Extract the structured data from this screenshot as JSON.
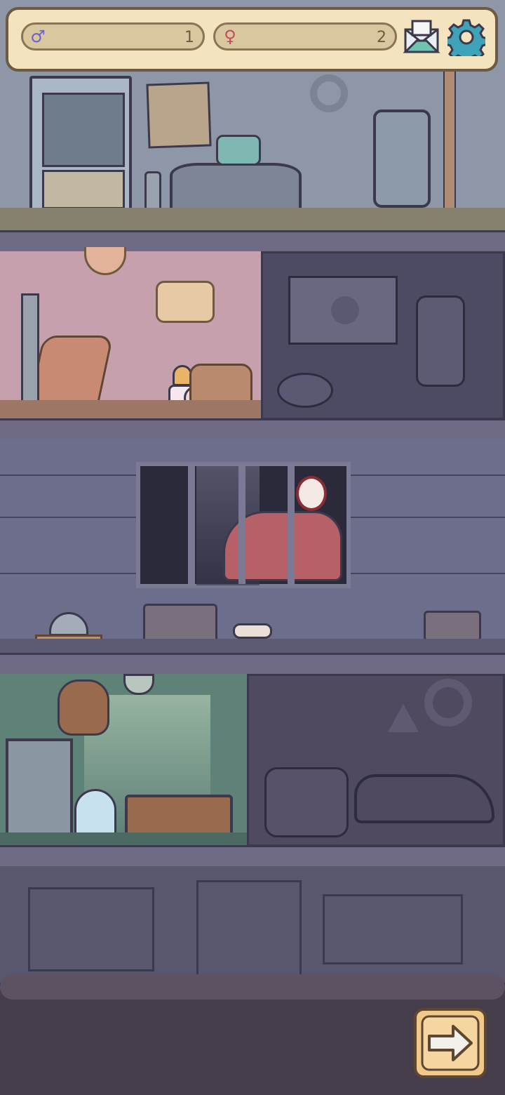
{
  "hud": {
    "male_icon": "male-symbol-icon",
    "male_count": "1",
    "female_icon": "female-symbol-icon",
    "female_count": "2",
    "mail_icon": "mail-icon",
    "settings_icon": "gear-icon"
  },
  "rooms": {
    "top_floor": "office-room",
    "playroom": "snail-playroom",
    "locked_gym": "locked-gym-room",
    "prison": "prison-cell",
    "storage": "storage-room",
    "locked_garage": "locked-garage-room",
    "foundation": "basement-foundation"
  },
  "buttons": {
    "next_icon": "arrow-right-icon"
  },
  "colors": {
    "hud_bg": "#f3e3bf",
    "hud_border": "#6f5a3f",
    "male_color": "#6a63c9",
    "female_color": "#c94a5a",
    "settings_color": "#3ea3b8",
    "next_button_bg": "#f0c98a"
  }
}
